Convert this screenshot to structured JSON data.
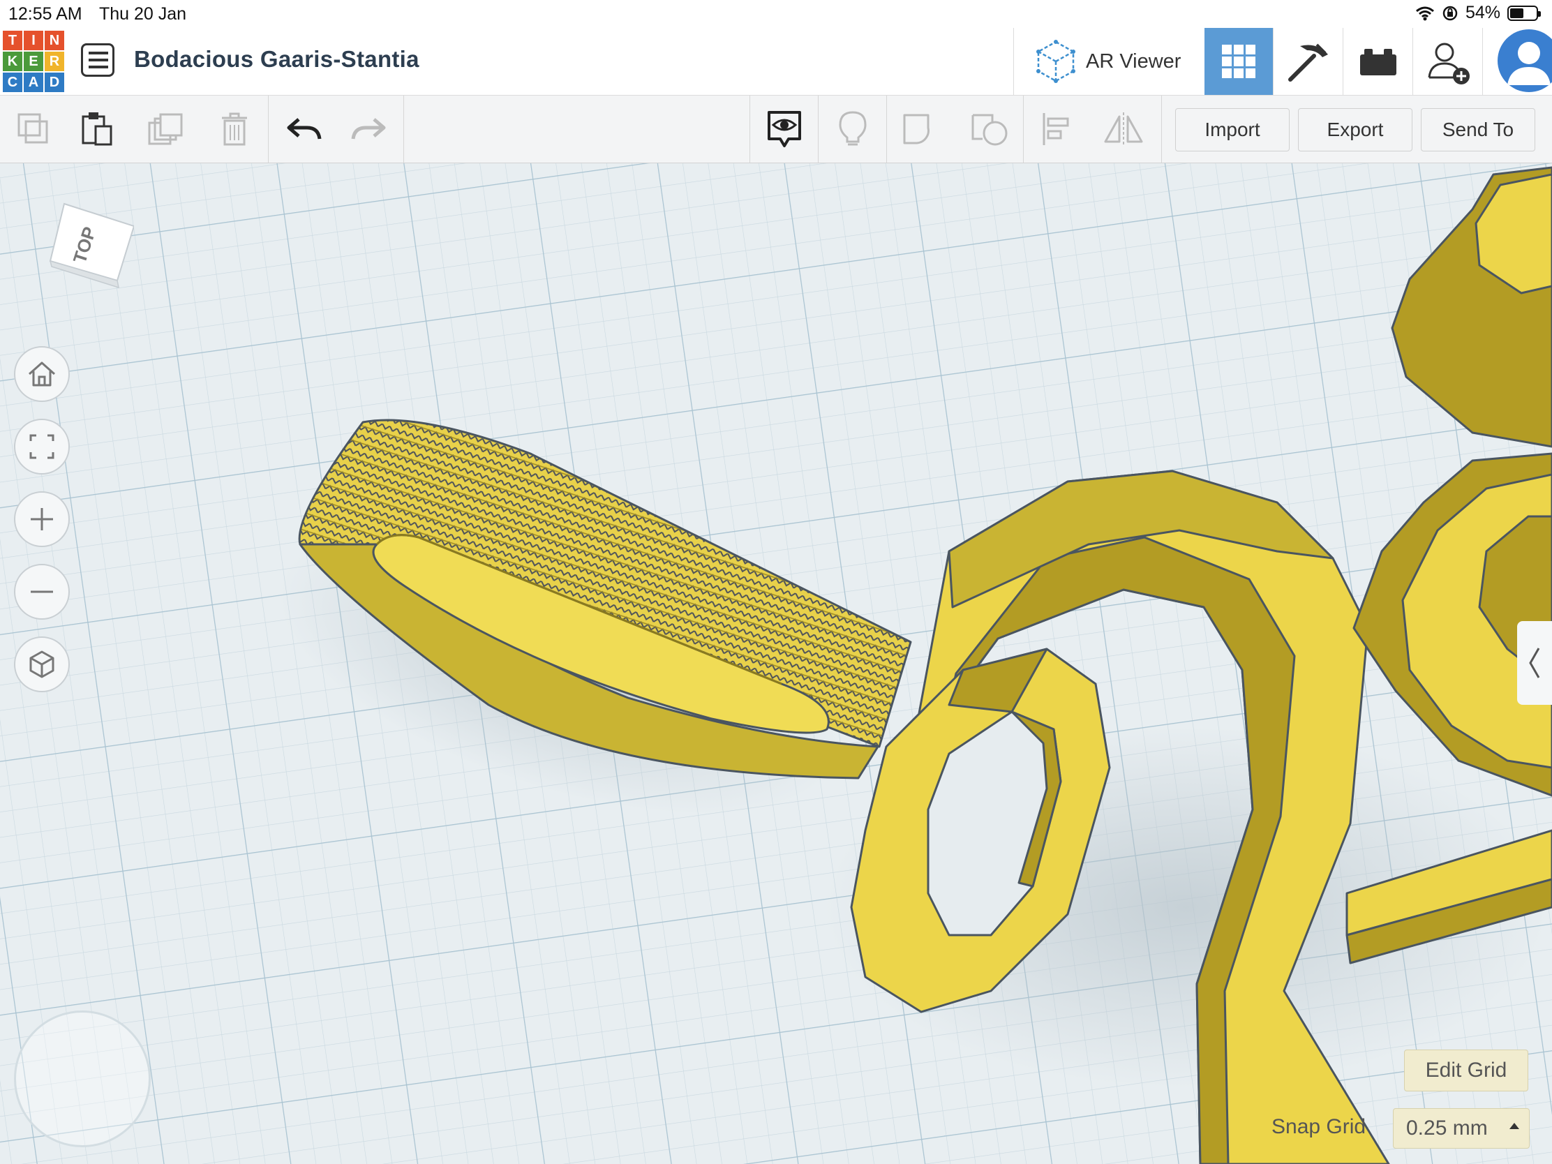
{
  "status_bar": {
    "time": "12:55 AM",
    "date": "Thu 20 Jan",
    "battery": "54%",
    "battery_level": 0.54
  },
  "logo": {
    "letters": [
      "T",
      "I",
      "N",
      "K",
      "E",
      "R",
      "C",
      "A",
      "D"
    ],
    "colors": [
      "#e5512c",
      "#e5512c",
      "#e5512c",
      "#4b9a3b",
      "#4b9a3b",
      "#f0b42b",
      "#2e7bc4",
      "#2e7bc4",
      "#2e7bc4"
    ]
  },
  "header": {
    "design_title": "Bodacious Gaaris-Stantia",
    "ar_viewer_label": "AR Viewer",
    "views": [
      {
        "icon": "grid-view-icon",
        "active": true
      },
      {
        "icon": "pickaxe-icon",
        "active": false
      },
      {
        "icon": "bricks-icon",
        "active": false
      },
      {
        "icon": "add-user-icon",
        "active": false
      }
    ]
  },
  "toolbar": {
    "import_label": "Import",
    "export_label": "Export",
    "send_to_label": "Send To",
    "tools": [
      "copy-icon",
      "paste-icon",
      "duplicate-icon",
      "delete-icon",
      "undo-icon",
      "redo-icon",
      "show-all-icon",
      "notes-light-icon",
      "group-icon",
      "ungroup-icon",
      "align-icon",
      "mirror-icon"
    ]
  },
  "viewcube": {
    "face_label": "TOP"
  },
  "nav_controls": [
    "home-view-icon",
    "fit-view-icon",
    "zoom-in-icon",
    "zoom-out-icon",
    "perspective-icon"
  ],
  "grid": {
    "edit_grid_label": "Edit Grid",
    "snap_grid_label": "Snap Grid",
    "snap_grid_value": "0.25 mm"
  },
  "colors": {
    "accent": "#5b9bd5",
    "shape_fill": "#ecd54a",
    "shape_shadow": "#b09a22",
    "shape_edge": "#4a5560"
  }
}
